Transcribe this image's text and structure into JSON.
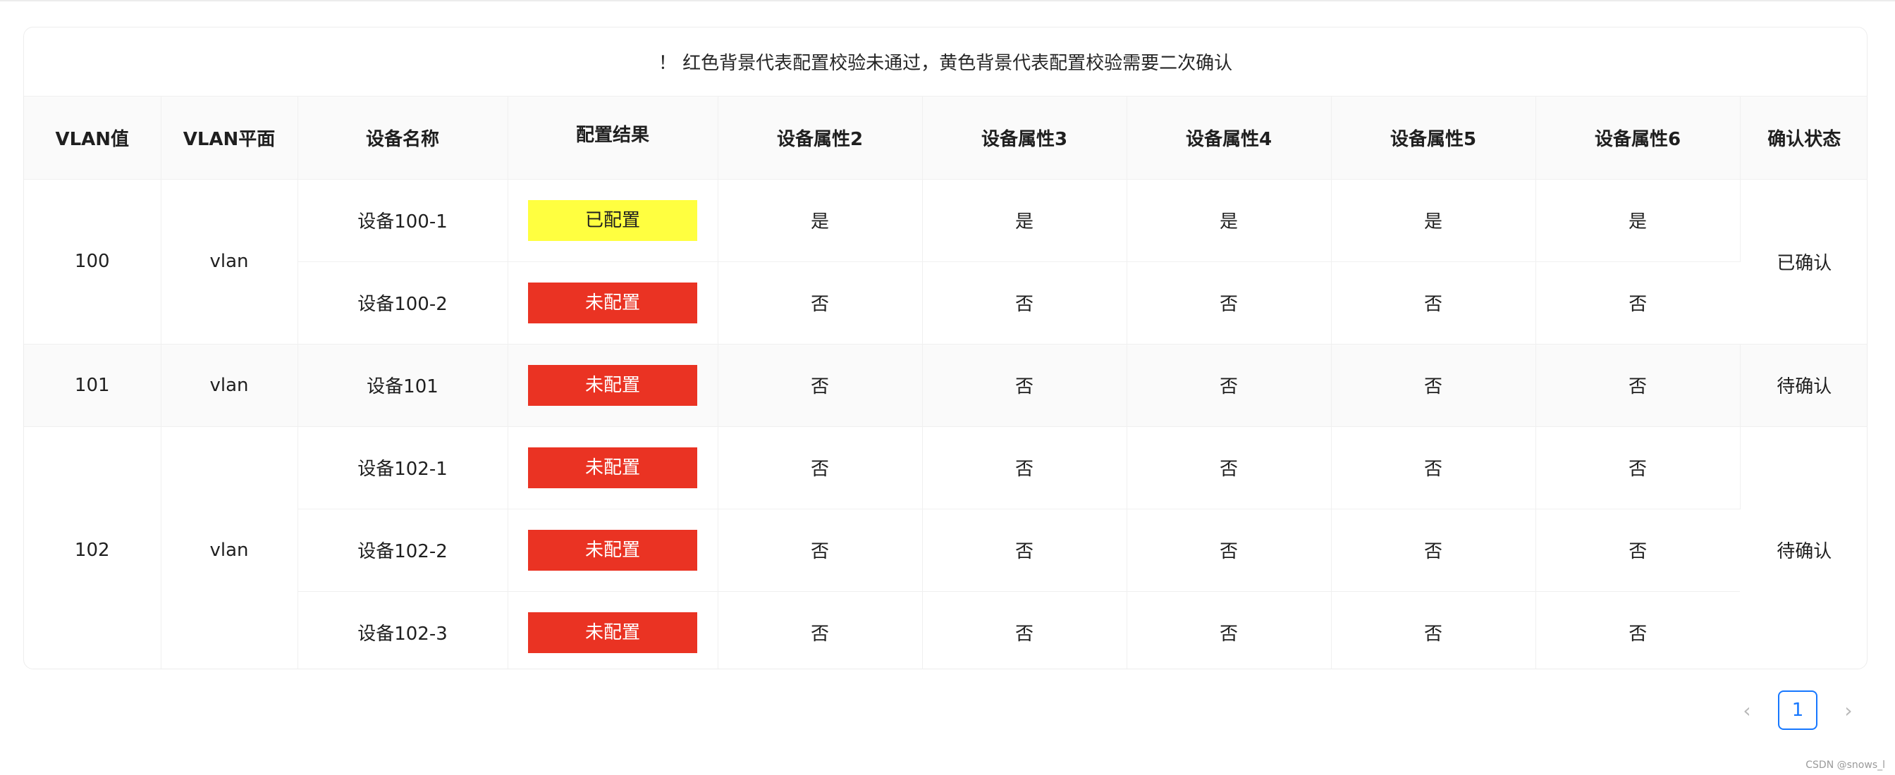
{
  "notice": "！ 红色背景代表配置校验未通过，黄色背景代表配置校验需要二次确认",
  "columns": [
    "VLAN值",
    "VLAN平面",
    "设备名称",
    "配置结果",
    "设备属性2",
    "设备属性3",
    "设备属性4",
    "设备属性5",
    "设备属性6",
    "确认状态"
  ],
  "groups": [
    {
      "vlan": "100",
      "plane": "vlan",
      "status": "已确认",
      "devices": [
        {
          "name": "设备100-1",
          "result": "已配置",
          "result_color": "#ffff40",
          "attrs": [
            "是",
            "是",
            "是",
            "是",
            "是"
          ]
        },
        {
          "name": "设备100-2",
          "result": "未配置",
          "result_color": "#ea3323",
          "attrs": [
            "否",
            "否",
            "否",
            "否",
            "否"
          ]
        }
      ]
    },
    {
      "vlan": "101",
      "plane": "vlan",
      "status": "待确认",
      "devices": [
        {
          "name": "设备101",
          "result": "未配置",
          "result_color": "#ea3323",
          "attrs": [
            "否",
            "否",
            "否",
            "否",
            "否"
          ]
        }
      ]
    },
    {
      "vlan": "102",
      "plane": "vlan",
      "status": "待确认",
      "devices": [
        {
          "name": "设备102-1",
          "result": "未配置",
          "result_color": "#ea3323",
          "attrs": [
            "否",
            "否",
            "否",
            "否",
            "否"
          ]
        },
        {
          "name": "设备102-2",
          "result": "未配置",
          "result_color": "#ea3323",
          "attrs": [
            "否",
            "否",
            "否",
            "否",
            "否"
          ]
        },
        {
          "name": "设备102-3",
          "result": "未配置",
          "result_color": "#ea3323",
          "attrs": [
            "否",
            "否",
            "否",
            "否",
            "否"
          ]
        }
      ]
    }
  ],
  "pagination": {
    "prev_icon": "chevron-left-icon",
    "current_page": "1",
    "next_icon": "chevron-right-icon"
  },
  "watermark": "CSDN @snows_l"
}
